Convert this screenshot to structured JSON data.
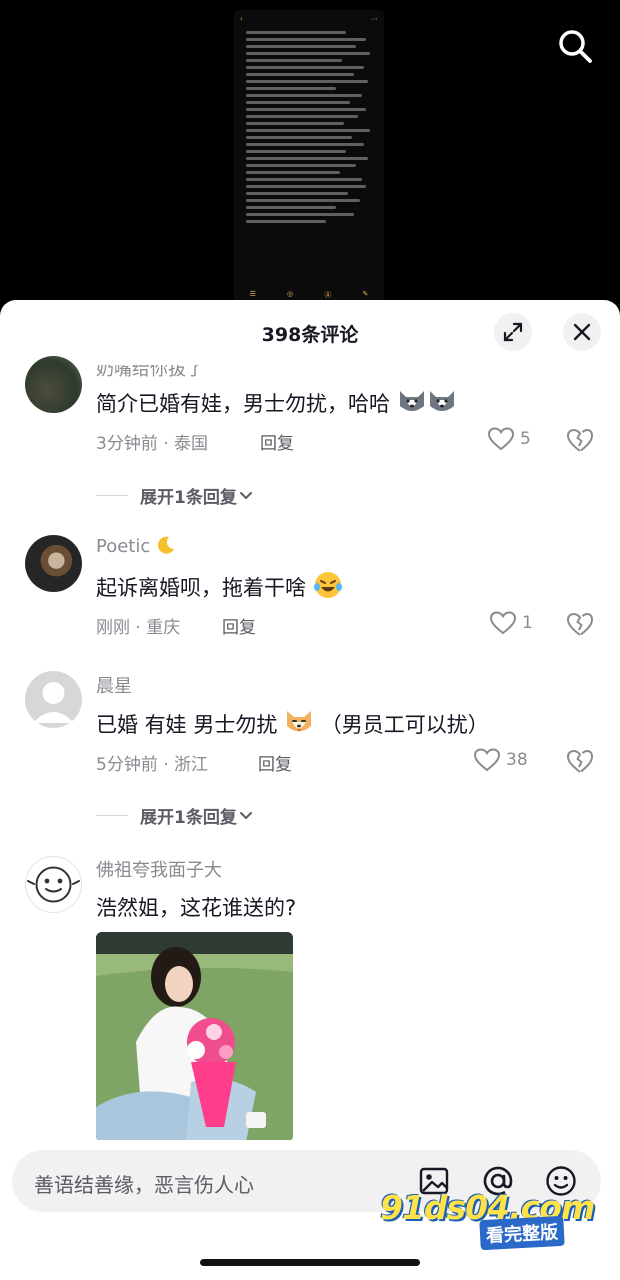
{
  "header": {
    "comment_count_title": "398条评论"
  },
  "comments": [
    {
      "username": "奶嘴给你拔了",
      "text": "简介已婚有娃，男士勿扰，哈哈",
      "time_location": "3分钟前 · 泰国",
      "reply_label": "回复",
      "likes": "5",
      "expand_label": "展开1条回复"
    },
    {
      "username": "Poetic",
      "text": "起诉离婚呗，拖着干啥",
      "time_location": "刚刚 · 重庆",
      "reply_label": "回复",
      "likes": "1"
    },
    {
      "username": "晨星",
      "text": "已婚 有娃 男士勿扰",
      "text_suffix": "（男员工可以扰）",
      "time_location": "5分钟前 · 浙江",
      "reply_label": "回复",
      "likes": "38",
      "expand_label": "展开1条回复"
    },
    {
      "username": "佛祖夸我面子大",
      "text": "浩然姐，这花谁送的?"
    }
  ],
  "input": {
    "placeholder": "善语结善缘，恶言伤人心"
  },
  "watermark": {
    "site": "91ds04.com",
    "tagline": "看完整版"
  },
  "icons": {
    "search": "search-icon",
    "expand": "fullscreen-icon",
    "close": "close-icon",
    "like": "heart-icon",
    "dislike": "broken-heart-icon",
    "image": "image-icon",
    "mention": "at-icon",
    "emoji": "emoji-icon"
  }
}
